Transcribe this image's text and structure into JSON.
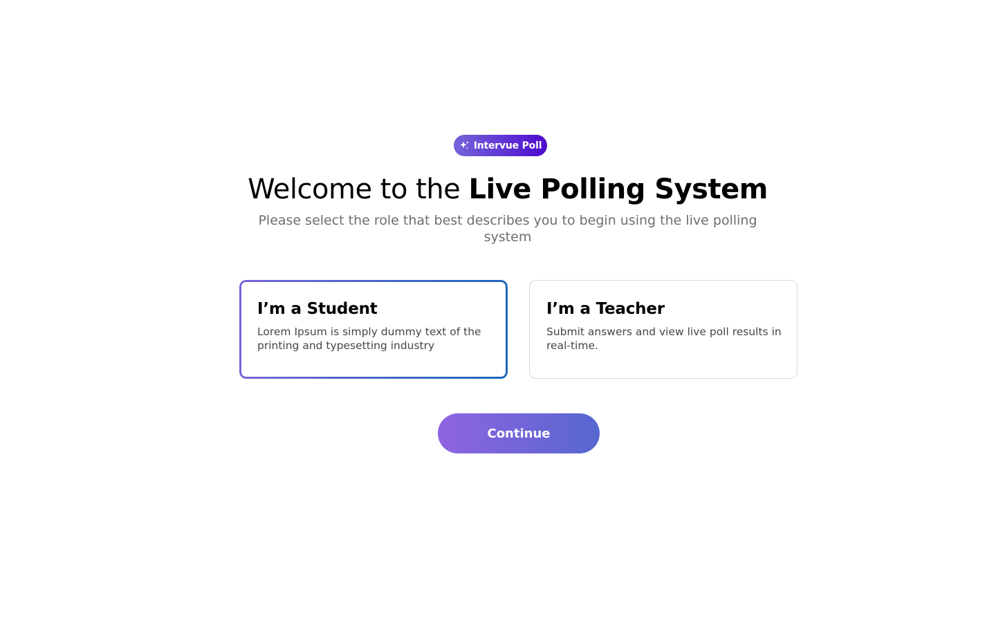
{
  "badge": {
    "label": "Intervue Poll",
    "icon": "sparkle-icon"
  },
  "header": {
    "title_prefix": "Welcome to the ",
    "title_strong": "Live Polling System",
    "subtitle": "Please select the role that best describes you to begin using the live polling system"
  },
  "roles": [
    {
      "title": "I’m a Student",
      "description": "Lorem Ipsum is simply dummy text of the printing and typesetting industry",
      "selected": true
    },
    {
      "title": "I’m a Teacher",
      "description": "Submit answers and view live poll results in real-time.",
      "selected": false
    }
  ],
  "actions": {
    "continue_label": "Continue"
  },
  "colors": {
    "badge_gradient_start": "#7565d9",
    "badge_gradient_end": "#4d0acd",
    "selected_border_start": "#7765da",
    "selected_border_end": "#1d68bd",
    "button_gradient_start": "#8f64e1",
    "button_gradient_end": "#5767d0",
    "subtitle_text": "#6e6e6e",
    "card_border": "#d9d9d9"
  }
}
